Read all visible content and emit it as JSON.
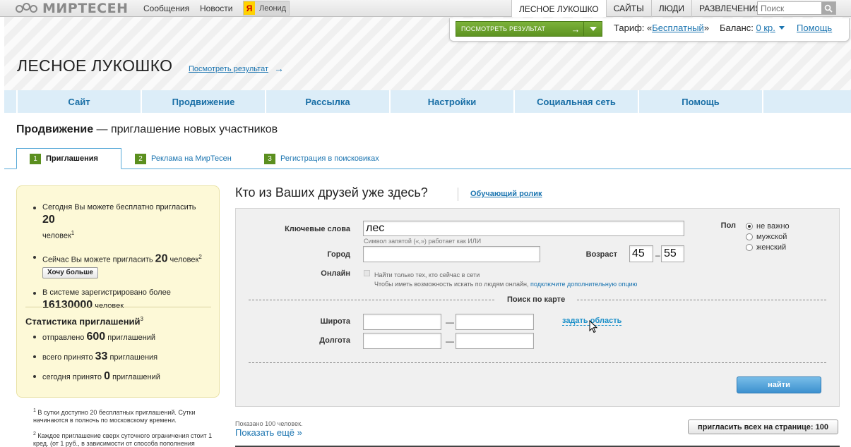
{
  "topbar": {
    "logo": "МИРТЕСЕН",
    "messages": "Сообщения",
    "news": "Новости",
    "ya": "Я",
    "user": "Леонид",
    "nav": [
      "ЛЕСНОЕ ЛУКОШКО",
      "САЙТЫ",
      "ЛЮДИ",
      "РАЗВЛЕЧЕНИЯ"
    ],
    "search_placeholder": "Поиск"
  },
  "result_panel": {
    "button": "ПОСМОТРЕТЬ РЕЗУЛЬТАТ",
    "arrow": "→",
    "tariff_label": "Тариф: «",
    "tariff_value": "Бесплатный",
    "tariff_close": "»",
    "balance_label": "Баланс: ",
    "balance_value": "0 кр.",
    "help": "Помощь"
  },
  "site": {
    "title": "ЛЕСНОЕ ЛУКОШКО",
    "view_result": "Посмотреть результат",
    "view_result_arrow": "→"
  },
  "main_nav": [
    "Сайт",
    "Продвижение",
    "Рассылка",
    "Настройки",
    "Социальная сеть",
    "Помощь"
  ],
  "page": {
    "heading_bold": "Продвижение",
    "heading_rest": " — приглашение новых участников"
  },
  "tabs": [
    {
      "num": "1",
      "label": "Приглашения"
    },
    {
      "num": "2",
      "label": "Реклама на МирТесен"
    },
    {
      "num": "3",
      "label": "Регистрация в поисковиках"
    }
  ],
  "sidebar": {
    "free_pre": "Сегодня Вы можете бесплатно пригласить ",
    "free_num": "20",
    "free_post": " человек",
    "free_sup": "1",
    "paid_pre": "Сейчас Вы можете пригласить ",
    "paid_num": "20",
    "paid_post": " человек",
    "paid_sup": "2",
    "more_btn": "Хочу больше",
    "registered_pre": "В системе зарегистрировано более",
    "registered_num": "16130000",
    "registered_post": " человек",
    "stats_title": "Статистика приглашений",
    "stats_sup": "3",
    "sent_pre": "отправлено ",
    "sent_num": "600",
    "sent_post": " приглашений",
    "accepted_pre": "всего принято ",
    "accepted_num": "33",
    "accepted_post": " приглашения",
    "today_pre": "сегодня принято ",
    "today_num": "0",
    "today_post": " приглашений"
  },
  "footnotes": {
    "n1": "1",
    "t1": " В сутки доступно 20 бесплатных приглашений. Сутки начинаются в полночь по московскому времени.",
    "n2": "2",
    "t2": " Каждое приглашение сверх суточного ограничения стоит 1 кред. (от 1 руб., в зависимости от способа пополнения"
  },
  "main": {
    "title": "Кто из Ваших друзей уже здесь?",
    "tutorial": "Обучающий ролик"
  },
  "form": {
    "keywords_label": "Ключевые слова",
    "keywords_value": "лес",
    "keywords_hint": "Символ запятой («,») работает как ИЛИ",
    "city_label": "Город",
    "city_value": "",
    "age_label": "Возраст",
    "age_from": "45",
    "age_dash": "–",
    "age_to": "55",
    "gender_label": "Пол",
    "gender_options": [
      "не важно",
      "мужской",
      "женский"
    ],
    "online_label": "Онлайн",
    "online_hint1": "Найти только тех, кто сейчас в сети",
    "online_hint2": "Чтобы иметь возможность искать по людям онлайн, ",
    "online_link": "подключите дополнительную опцию",
    "map_title": "Поиск по карте",
    "lat_label": "Широта",
    "lon_label": "Долгота",
    "range_dash": "—",
    "area_link": "задать область",
    "find_button": "найти"
  },
  "results": {
    "shown": "Показано 100 человек.",
    "show_more": "Показать ещё »",
    "invite_all": "пригласить всех на странице: 100"
  }
}
